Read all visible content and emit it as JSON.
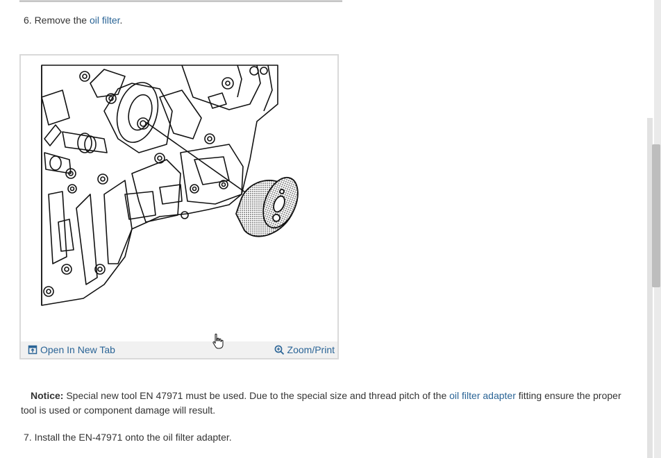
{
  "steps": {
    "step6_prefix": "6. Remove the ",
    "step6_link": "oil filter",
    "step6_suffix": ".",
    "step7_text": "7. Install the EN-47971 onto the oil filter adapter."
  },
  "figure": {
    "open_tab_label": "Open In New Tab",
    "zoom_label": "Zoom/Print",
    "icons": [
      "open-in-new-tab-icon",
      "zoom-in-icon"
    ]
  },
  "notice": {
    "label": "Notice:",
    "text_before": " Special new tool EN 47971 must be used. Due to the special size and thread pitch of the ",
    "link": "oil filter adapter",
    "text_after": " fitting ensure the proper tool is used or component damage will result."
  },
  "colors": {
    "link": "#2a6496",
    "text": "#333333",
    "footer_bg": "#f1f1f1"
  }
}
